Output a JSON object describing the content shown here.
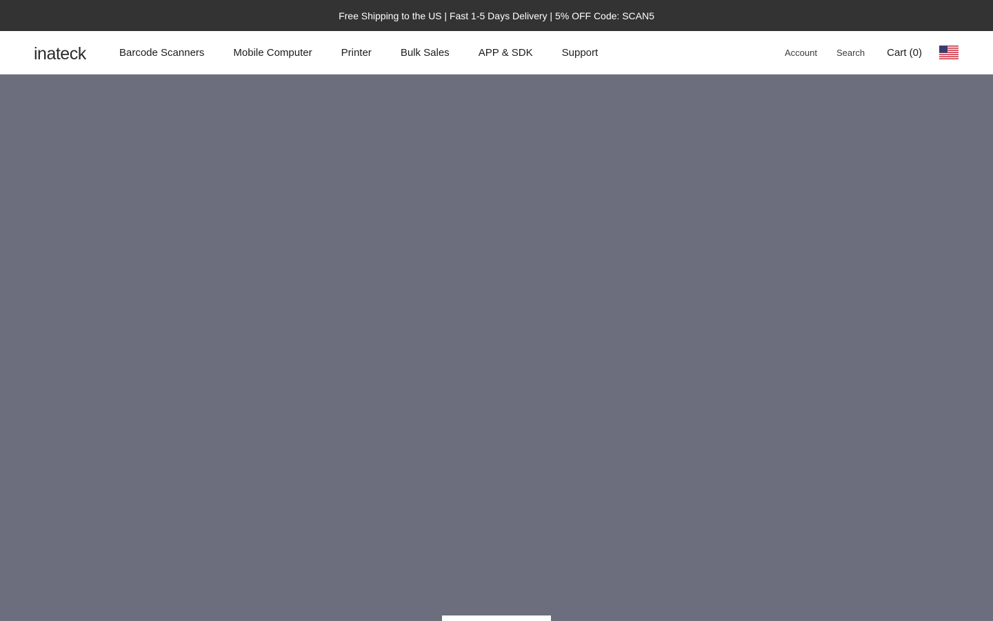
{
  "announcement": {
    "text": "Free Shipping to the US | Fast 1-5 Days Delivery | 5% OFF Code: SCAN5"
  },
  "header": {
    "logo_text": "inateck",
    "nav": [
      {
        "label": "Barcode Scanners"
      },
      {
        "label": "Mobile Computer"
      },
      {
        "label": "Printer"
      },
      {
        "label": "Bulk Sales"
      },
      {
        "label": "APP & SDK"
      },
      {
        "label": "Support"
      }
    ],
    "account_label": "Account",
    "search_label": "Search",
    "cart_label": "Cart (0)",
    "flag_icon": "us-flag-icon"
  },
  "colors": {
    "announcement_bg": "#333333",
    "hero_bg": "#6c6e7d",
    "text_dark": "#1c1c1c"
  }
}
